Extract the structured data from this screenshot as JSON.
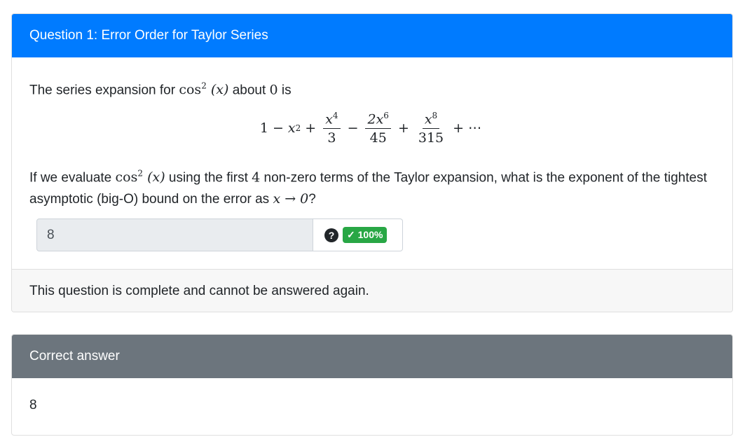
{
  "question_card": {
    "header": "Question 1: Error Order for Taylor Series",
    "intro": {
      "before": "The series expansion for ",
      "func": "cos",
      "func_power": "2",
      "arg": "(x)",
      "middle": " about ",
      "point": "0",
      "after": " is"
    },
    "formula": {
      "t1": "1",
      "op1": "−",
      "t2": "x",
      "t2_exp": "2",
      "op2": "+",
      "f1_num": "x",
      "f1_num_exp": "4",
      "f1_den": "3",
      "op3": "−",
      "f2_num": "2x",
      "f2_num_exp": "6",
      "f2_den": "45",
      "op4": "+",
      "f3_num": "x",
      "f3_num_exp": "8",
      "f3_den": "315",
      "tail": "+ ⋯"
    },
    "prompt": {
      "a": "If we evaluate ",
      "func": "cos",
      "func_power": "2",
      "arg": "(x)",
      "b": " using the first ",
      "n": "4",
      "c": " non-zero terms of the Taylor expansion, what is the exponent of the tightest asymptotic (big-O) bound on the error as ",
      "limit": "x → 0",
      "d": "?"
    },
    "answer_value": "8",
    "help_icon": "question-circle-icon",
    "help_glyph": "?",
    "score_badge": "✓ 100%",
    "score_color": "#28a745",
    "footer": "This question is complete and cannot be answered again."
  },
  "answer_card": {
    "header": "Correct answer",
    "value": "8"
  },
  "colors": {
    "primary": "#007bff",
    "secondary": "#6c757d"
  }
}
